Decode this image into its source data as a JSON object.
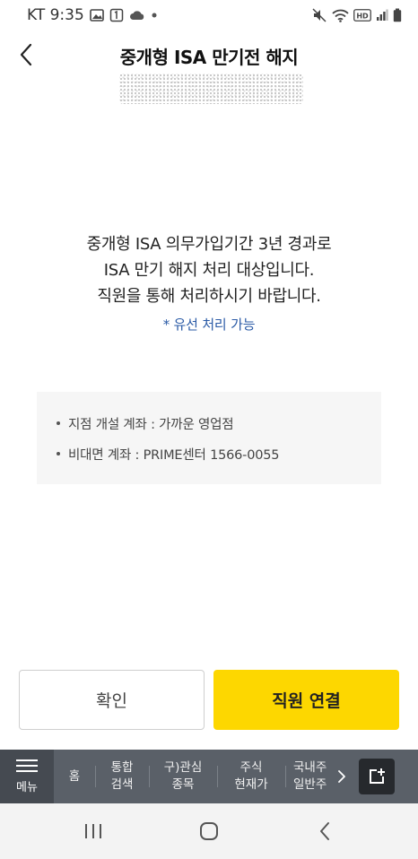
{
  "status_bar": {
    "carrier_time": "KT 9:35",
    "hd_badge": "HD",
    "icons_left": [
      "image-icon",
      "notification-icon",
      "cloud-icon",
      "dot-icon"
    ],
    "icons_right": [
      "mute-icon",
      "wifi-icon",
      "hd-icon",
      "signal-icon",
      "battery-icon"
    ]
  },
  "header": {
    "title": "중개형 ISA 만기전 해지"
  },
  "message": {
    "line1": "중개형 ISA 의무가입기간 3년 경과로",
    "line2": "ISA 만기 해지 처리 대상입니다.",
    "line3": "직원을 통해 처리하시기 바랍니다.",
    "note": "* 유선 처리 가능"
  },
  "info": {
    "items": [
      "지점 개설 계좌 : 가까운 영업점",
      "비대면 계좌 : PRIME센터 1566-0055"
    ]
  },
  "buttons": {
    "confirm": "확인",
    "connect": "직원 연결"
  },
  "bottom_nav": {
    "menu": "메뉴",
    "home": "홈",
    "search_l1": "통합",
    "search_l2": "검색",
    "watch_l1": "구)관심",
    "watch_l2": "종목",
    "price_l1": "주식",
    "price_l2": "현재가",
    "domestic_l1": "국내주",
    "domestic_l2": "일반주"
  },
  "colors": {
    "accent_yellow": "#fdd700",
    "note_blue": "#2a5aa6",
    "nav_bg": "#5a6068"
  }
}
